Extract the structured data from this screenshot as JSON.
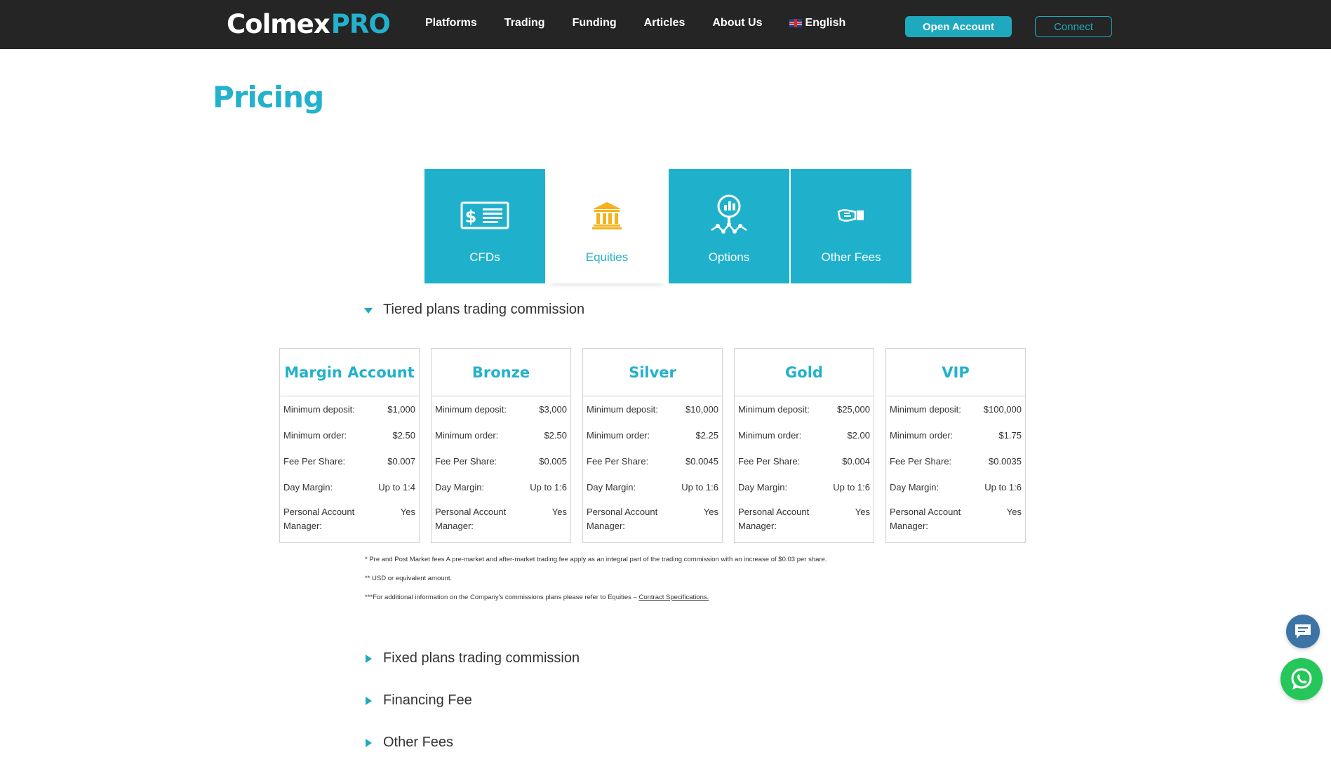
{
  "header": {
    "logo": {
      "part1": "Colmex",
      "part2": "PRO"
    },
    "nav": [
      "Platforms",
      "Trading",
      "Funding",
      "Articles",
      "About Us",
      "English"
    ],
    "open_account": "Open Account",
    "connect": "Connect"
  },
  "page": {
    "title": "Pricing"
  },
  "tabs": [
    {
      "label": "CFDs",
      "icon": "cheque-icon",
      "active": false
    },
    {
      "label": "Equities",
      "icon": "bank-icon",
      "active": true
    },
    {
      "label": "Options",
      "icon": "analytics-icon",
      "active": false
    },
    {
      "label": "Other Fees",
      "icon": "handshake-icon",
      "active": false
    }
  ],
  "accordion": {
    "tiered": "Tiered plans trading commission",
    "fixed": "Fixed plans trading commission",
    "financing": "Financing Fee",
    "other": "Other Fees"
  },
  "row_labels": {
    "min_deposit": "Minimum deposit:",
    "min_order": "Minimum order:",
    "fee_share": "Fee Per Share:",
    "day_margin": "Day Margin:",
    "manager": "Personal Account Manager:"
  },
  "plans": [
    {
      "name": "Margin Account",
      "min_deposit": "$1,000",
      "min_order": "$2.50",
      "fee_share": "$0.007",
      "day_margin": "Up to 1:4",
      "manager": "Yes"
    },
    {
      "name": "Bronze",
      "min_deposit": "$3,000",
      "min_order": "$2.50",
      "fee_share": "$0.005",
      "day_margin": "Up to 1:6",
      "manager": "Yes"
    },
    {
      "name": "Silver",
      "min_deposit": "$10,000",
      "min_order": "$2.25",
      "fee_share": "$0.0045",
      "day_margin": "Up to 1:6",
      "manager": "Yes"
    },
    {
      "name": "Gold",
      "min_deposit": "$25,000",
      "min_order": "$2.00",
      "fee_share": "$0.004",
      "day_margin": "Up to 1:6",
      "manager": "Yes"
    },
    {
      "name": "VIP",
      "min_deposit": "$100,000",
      "min_order": "$1.75",
      "fee_share": "$0.0035",
      "day_margin": "Up to 1:6",
      "manager": "Yes"
    }
  ],
  "notes": {
    "n1": "* Pre and Post Market fees A pre-market and after-market trading fee apply as an integral part of the trading commission with an increase of $0.03 per share.",
    "n2": "** USD or equivalent amount.",
    "n3_text": "***For additional information on the Company's commissions plans please refer to Equities – ",
    "n3_link": "Contract Specifications."
  },
  "colors": {
    "accent": "#23b1cc",
    "topbar": "#252525",
    "whatsapp": "#25c65a",
    "chat": "#3c74a5"
  }
}
